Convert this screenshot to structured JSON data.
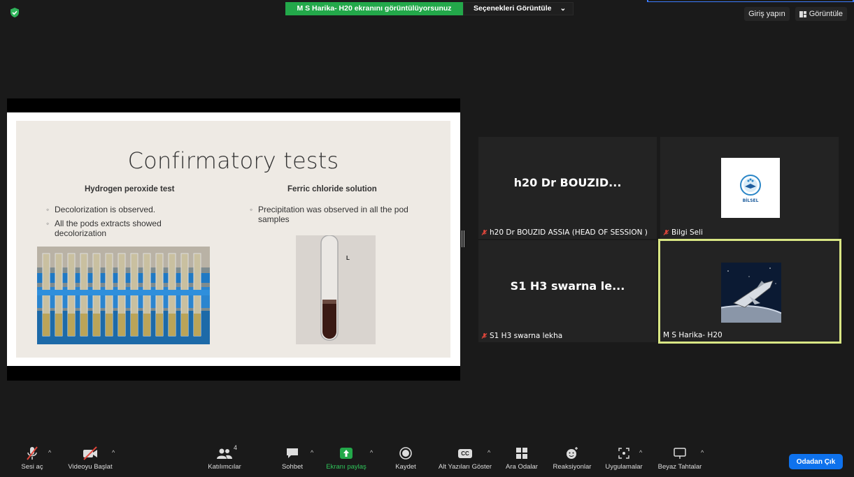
{
  "top": {
    "share_banner": "M S Harika- H20 ekranını görüntülüyorsunuz",
    "view_options": "Seçenekleri Görüntüle",
    "view_options_caret": "⌄",
    "sign_in": "Giriş yapın",
    "view": "Görüntüle"
  },
  "slide": {
    "title": "Confirmatory tests",
    "left_heading": "Hydrogen peroxide test",
    "right_heading": "Ferric chloride solution",
    "left_bullets": [
      "Decolorization is observed.",
      "All the pods extracts showed decolorization"
    ],
    "right_bullets": [
      "Precipitation was observed in all the pod samples"
    ],
    "tube_mark": "L"
  },
  "tiles": [
    {
      "display": "h20 Dr BOUZID...",
      "label": "h20 Dr BOUZID ASSIA (HEAD OF SESSION )",
      "muted": true
    },
    {
      "display": "",
      "label": "Bilgi Seli",
      "muted": true,
      "logo_text": "BİLSEL"
    },
    {
      "display": "S1 H3 swarna le...",
      "label": "S1 H3 swarna lekha",
      "muted": true
    },
    {
      "display": "",
      "label": "M S Harika- H20",
      "muted": false,
      "active_speaker": true
    }
  ],
  "toolbar": {
    "audio": "Sesi aç",
    "video": "Videoyu Başlat",
    "participants": "Katılımcılar",
    "participants_count": "4",
    "chat": "Sohbet",
    "share": "Ekranı paylaş",
    "record": "Kaydet",
    "captions": "Alt Yazıları Göster",
    "captions_icon_text": "CC",
    "breakout": "Ara Odalar",
    "reactions": "Reaksiyonlar",
    "apps": "Uygulamalar",
    "whiteboard": "Beyaz Tahtalar",
    "leave": "Odadan Çık",
    "caret": "^"
  },
  "colors": {
    "share_green": "#23a84a",
    "leave_blue": "#0e72ed",
    "active_border": "#d9e684",
    "muted_red": "#e0463b"
  }
}
